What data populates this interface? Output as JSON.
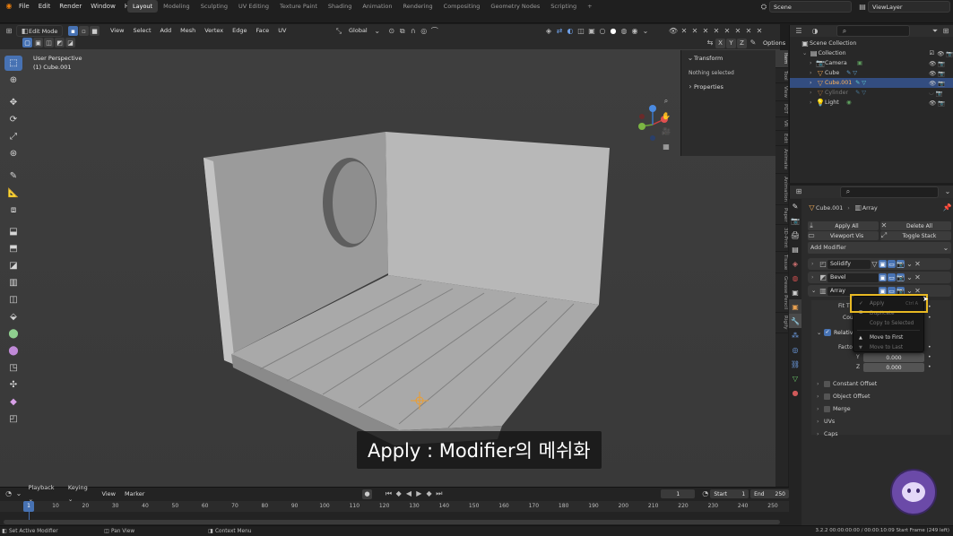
{
  "topbar": {
    "menus": [
      "File",
      "Edit",
      "Render",
      "Window",
      "Help"
    ],
    "workspaces": [
      "Layout",
      "Modeling",
      "Sculpting",
      "UV Editing",
      "Texture Paint",
      "Shading",
      "Animation",
      "Rendering",
      "Compositing",
      "Geometry Nodes",
      "Scripting"
    ],
    "active_workspace": "Layout",
    "add_tab": "+",
    "scene": "Scene",
    "view_layer": "ViewLayer"
  },
  "viewport_header": {
    "mode": "Edit Mode",
    "menus": [
      "View",
      "Select",
      "Add",
      "Mesh",
      "Vertex",
      "Edge",
      "Face",
      "UV"
    ],
    "orientation": "Global",
    "axes": [
      "X",
      "Y",
      "Z"
    ],
    "options": "Options"
  },
  "viewport": {
    "perspective": "User Perspective",
    "object_info": "(1) Cube.001"
  },
  "npanel": {
    "transform": "Transform",
    "nothing_selected": "Nothing selected",
    "properties": "Properties",
    "tabs": [
      "Item",
      "Tool",
      "View",
      "PDT",
      "VR",
      "Edit",
      "Animate",
      "Animation",
      "Paper",
      "3D-Print",
      "Tissue",
      "Grease Pencil",
      "Rigify"
    ],
    "active_tab": "Item"
  },
  "outliner": {
    "root": "Scene Collection",
    "collection": "Collection",
    "items": [
      {
        "name": "Camera",
        "color": "#e8a050"
      },
      {
        "name": "Cube",
        "color": "#e8a050"
      },
      {
        "name": "Cube.001",
        "color": "#e8a050"
      },
      {
        "name": "Cylinder",
        "color": "#e8a050"
      },
      {
        "name": "Light",
        "color": "#e8a050"
      }
    ]
  },
  "properties": {
    "object": "Cube.001",
    "modifier_crumb": "Array",
    "apply_all": "Apply All",
    "delete_all": "Delete All",
    "viewport_vis": "Viewport Vis",
    "toggle_stack": "Toggle Stack",
    "add_modifier": "Add Modifier",
    "modifiers": [
      "Solidify",
      "Bevel",
      "Array"
    ],
    "fit_label": "Fit T",
    "count_label": "Cou",
    "relative_offset": "Relative",
    "factor_label": "Factor",
    "y_label": "Y",
    "y_value": "0.000",
    "z_label": "Z",
    "z_value": "0.000",
    "subpanels": [
      "Constant Offset",
      "Object Offset",
      "Merge",
      "UVs",
      "Caps"
    ]
  },
  "context_menu": {
    "apply": "Apply",
    "apply_shortcut": "Ctrl A",
    "duplicate": "Duplicate",
    "copy_to_selected": "Copy to Selected",
    "move_to_first": "Move to First",
    "move_to_last": "Move to Last"
  },
  "subtitle": "Apply : Modifier의 메쉬화",
  "timeline": {
    "menus": [
      "Playback",
      "Keying",
      "View",
      "Marker"
    ],
    "current_frame": "1",
    "start_label": "Start",
    "start": "1",
    "end_label": "End",
    "end": "250",
    "ticks": [
      "1",
      "10",
      "20",
      "30",
      "40",
      "50",
      "60",
      "70",
      "80",
      "90",
      "100",
      "110",
      "120",
      "130",
      "140",
      "150",
      "160",
      "170",
      "180",
      "190",
      "200",
      "210",
      "220",
      "230",
      "240",
      "250"
    ]
  },
  "status": {
    "left": "Set Active Modifier",
    "pan": "Pan View",
    "context": "Context Menu",
    "right": "3.2.2   00:00:00:00 / 00:00:10:09   Start Frame (249 left)"
  },
  "colors": {
    "accent": "#4772b3",
    "highlight": "#e8b923",
    "selected_row": "#334d80"
  }
}
